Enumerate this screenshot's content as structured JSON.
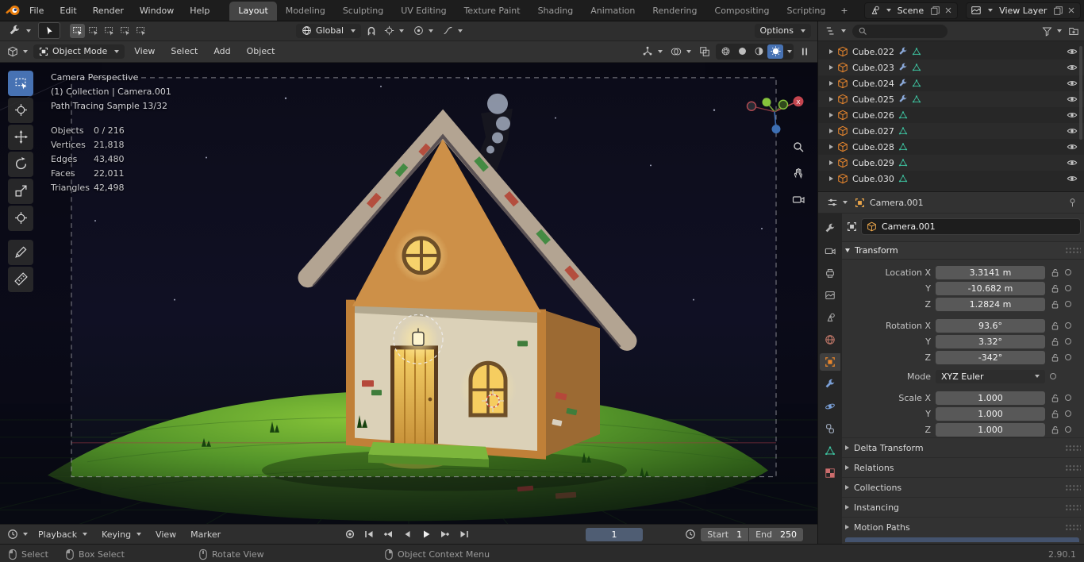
{
  "topbar": {
    "menus": [
      "File",
      "Edit",
      "Render",
      "Window",
      "Help"
    ],
    "workspaces": [
      "Layout",
      "Modeling",
      "Sculpting",
      "UV Editing",
      "Texture Paint",
      "Shading",
      "Animation",
      "Rendering",
      "Compositing",
      "Scripting"
    ],
    "active_workspace": "Layout",
    "add_workspace_label": "+",
    "scene_label": "Scene",
    "view_layer_label": "View Layer"
  },
  "tool_settings": {
    "orientation_label": "Global",
    "options_label": "Options"
  },
  "viewport": {
    "mode_label": "Object Mode",
    "menus": [
      "View",
      "Select",
      "Add",
      "Object"
    ],
    "gizmo_x_label": "X",
    "overlay": {
      "view_label": "Camera Perspective",
      "context_label": "(1) Collection | Camera.001",
      "sampling_label": "Path Tracing Sample 13/32",
      "stats": [
        {
          "label": "Objects",
          "value": "0 / 216"
        },
        {
          "label": "Vertices",
          "value": "21,818"
        },
        {
          "label": "Edges",
          "value": "43,480"
        },
        {
          "label": "Faces",
          "value": "22,011"
        },
        {
          "label": "Triangles",
          "value": "42,498"
        }
      ]
    }
  },
  "outliner": {
    "items": [
      {
        "name": "Cube.022",
        "has_modifier": true
      },
      {
        "name": "Cube.023",
        "has_modifier": true
      },
      {
        "name": "Cube.024",
        "has_modifier": true
      },
      {
        "name": "Cube.025",
        "has_modifier": true
      },
      {
        "name": "Cube.026",
        "has_modifier": false
      },
      {
        "name": "Cube.027",
        "has_modifier": false
      },
      {
        "name": "Cube.028",
        "has_modifier": false
      },
      {
        "name": "Cube.029",
        "has_modifier": false
      },
      {
        "name": "Cube.030",
        "has_modifier": false
      }
    ]
  },
  "properties": {
    "breadcrumb_object": "Camera.001",
    "name_value": "Camera.001",
    "transform_title": "Transform",
    "fields": [
      {
        "label": "Location X",
        "value": "3.3141 m"
      },
      {
        "label": "Y",
        "value": "-10.682 m"
      },
      {
        "label": "Z",
        "value": "1.2824 m"
      },
      {
        "label": "Rotation X",
        "value": "93.6°"
      },
      {
        "label": "Y",
        "value": "3.32°"
      },
      {
        "label": "Z",
        "value": "-342°"
      },
      {
        "label": "Mode",
        "value": "XYZ Euler"
      },
      {
        "label": "Scale X",
        "value": "1.000"
      },
      {
        "label": "Y",
        "value": "1.000"
      },
      {
        "label": "Z",
        "value": "1.000"
      }
    ],
    "sections": [
      "Delta Transform",
      "Relations",
      "Collections",
      "Instancing",
      "Motion Paths"
    ]
  },
  "timeline": {
    "menus": [
      "Playback",
      "Keying",
      "View",
      "Marker"
    ],
    "current_frame": "1",
    "start_label": "Start",
    "start_value": "1",
    "end_label": "End",
    "end_value": "250"
  },
  "statusbar": {
    "hints": [
      "Select",
      "Box Select",
      "Rotate View",
      "Object Context Menu"
    ],
    "version": "2.90.1"
  },
  "colors": {
    "accent_blue": "#4772b3",
    "object_orange": "#e8862d",
    "mesh_green": "#3dbf9d"
  }
}
